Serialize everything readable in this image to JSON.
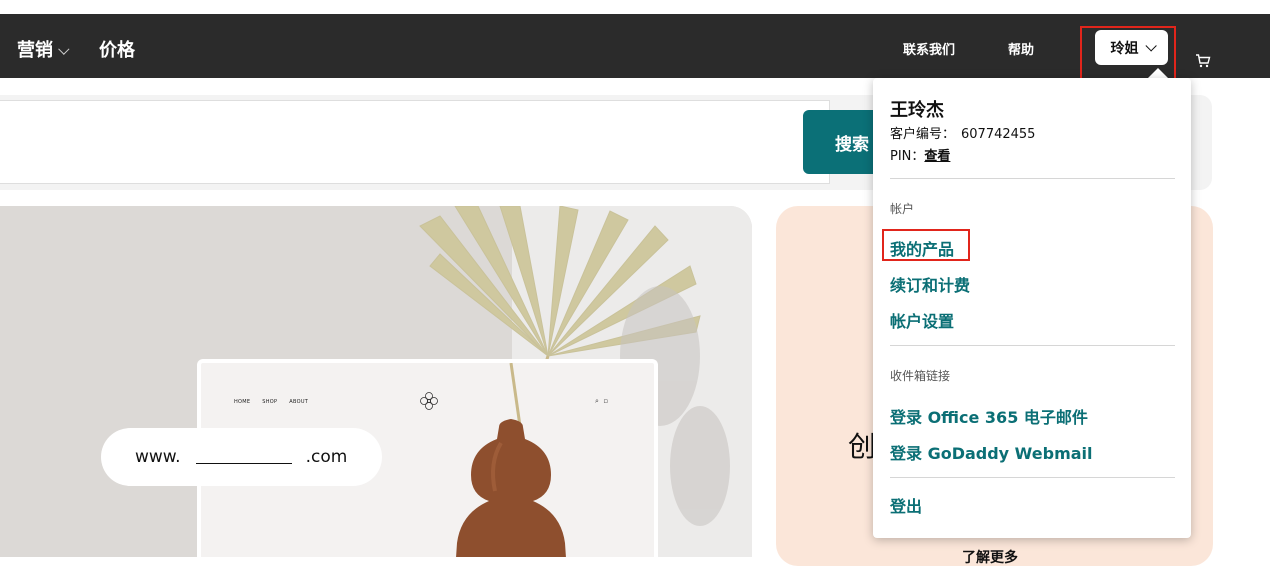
{
  "nav": {
    "marketing": "营销",
    "pricing": "价格",
    "contact": "联系我们",
    "help": "帮助",
    "user_button": "玲姐",
    "cart_icon": "cart-icon"
  },
  "search": {
    "button_label": "搜索",
    "placeholder": ""
  },
  "hero": {
    "mock_nav": [
      "HOME",
      "SHOP",
      "ABOUT"
    ],
    "domain_prefix": "www.",
    "domain_suffix": ".com"
  },
  "side_card": {
    "heading_fragment": "创",
    "more_link": "了解更多"
  },
  "account_menu": {
    "name": "王玲杰",
    "customer_label": "客户编号：",
    "customer_number": "607742455",
    "pin_label": "PIN：",
    "pin_link": "查看",
    "section_account": "帐户",
    "my_products": "我的产品",
    "renewals_billing": "续订和计费",
    "account_settings": "帐户设置",
    "section_inbox": "收件箱链接",
    "office365_login": "登录 Office 365 电子邮件",
    "webmail_login": "登录 GoDaddy Webmail",
    "sign_out": "登出"
  },
  "colors": {
    "navbar": "#2b2b2b",
    "accent_teal": "#0b7077",
    "highlight_red": "#e1251b",
    "peach_card": "#fbe6d9"
  }
}
